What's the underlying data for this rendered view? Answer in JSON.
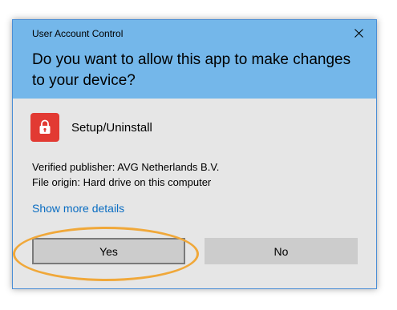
{
  "window": {
    "title": "User Account Control",
    "close_icon": "close-icon"
  },
  "prompt": {
    "question": "Do you want to allow this app to make changes to your device?"
  },
  "app": {
    "icon": "avg-shield-lock-icon",
    "icon_color": "#e23a33",
    "name": "Setup/Uninstall"
  },
  "details": {
    "publisher": "Verified publisher: AVG Netherlands B.V.",
    "origin": "File origin: Hard drive on this computer"
  },
  "links": {
    "show_more": "Show more details"
  },
  "buttons": {
    "yes": "Yes",
    "no": "No"
  },
  "colors": {
    "header": "#74b7ea",
    "body": "#e6e6e6",
    "link": "#0a6dc2",
    "highlight": "#f0a83a"
  }
}
